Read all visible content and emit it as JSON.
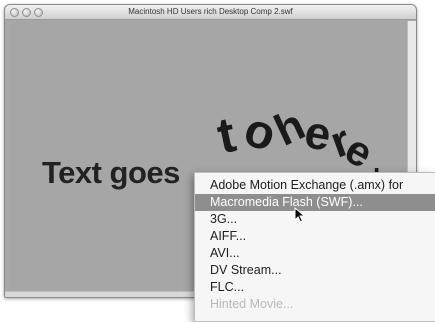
{
  "window": {
    "title": "Macintosh HD Users rich Desktop Comp 2.swf"
  },
  "stage": {
    "headline": "Text goes",
    "scrambled_text": "to here"
  },
  "menu": {
    "items": [
      {
        "label": "Adobe Motion Exchange (.amx) for",
        "state": "normal"
      },
      {
        "label": "Macromedia Flash (SWF)...",
        "state": "selected"
      },
      {
        "label": "3G...",
        "state": "normal"
      },
      {
        "label": "AIFF...",
        "state": "normal"
      },
      {
        "label": "AVI...",
        "state": "normal"
      },
      {
        "label": "DV Stream...",
        "state": "normal"
      },
      {
        "label": "FLC...",
        "state": "normal"
      },
      {
        "label": "Hinted Movie...",
        "state": "disabled"
      }
    ]
  },
  "colors": {
    "selection": "#8e8e8e",
    "stage_background": "#a6a6a6"
  },
  "icons": [
    "close-button-icon",
    "minimize-button-icon",
    "zoom-button-icon",
    "arrow-cursor-icon"
  ]
}
